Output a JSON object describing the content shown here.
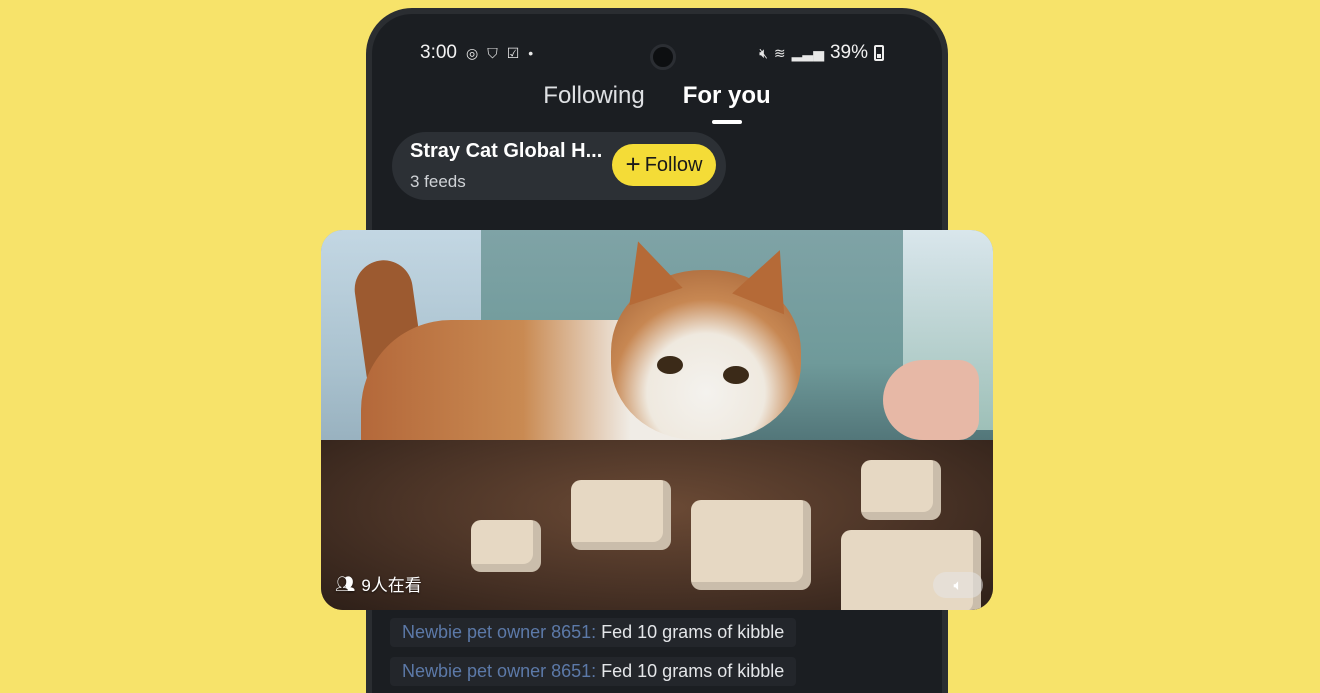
{
  "statusbar": {
    "time": "3:00",
    "battery": "39%",
    "left_icons": [
      "circle-gauge-icon",
      "shield-icon",
      "check-square-icon",
      "dot-icon"
    ],
    "right_icons": [
      "mute-icon",
      "wifi-icon",
      "signal-icon",
      "battery-icon"
    ]
  },
  "tabs": [
    {
      "label": "Following",
      "active": false
    },
    {
      "label": "For you",
      "active": true
    }
  ],
  "channel": {
    "name": "Stray Cat Global H...",
    "subtitle": "3 feeds",
    "follow_label": "Follow"
  },
  "video": {
    "viewers": "9人在看",
    "mute_icon": "speaker-icon"
  },
  "feed": [
    {
      "user": "Newbie pet owner 8651:",
      "message": "Fed 10 grams of kibble"
    },
    {
      "user": "Newbie pet owner 8651:",
      "message": "Fed 10 grams of kibble"
    }
  ],
  "colors": {
    "background": "#f7e36a",
    "phone": "#1b1e22",
    "follow_button": "#f4dc37",
    "feed_user": "#5c79a8"
  }
}
